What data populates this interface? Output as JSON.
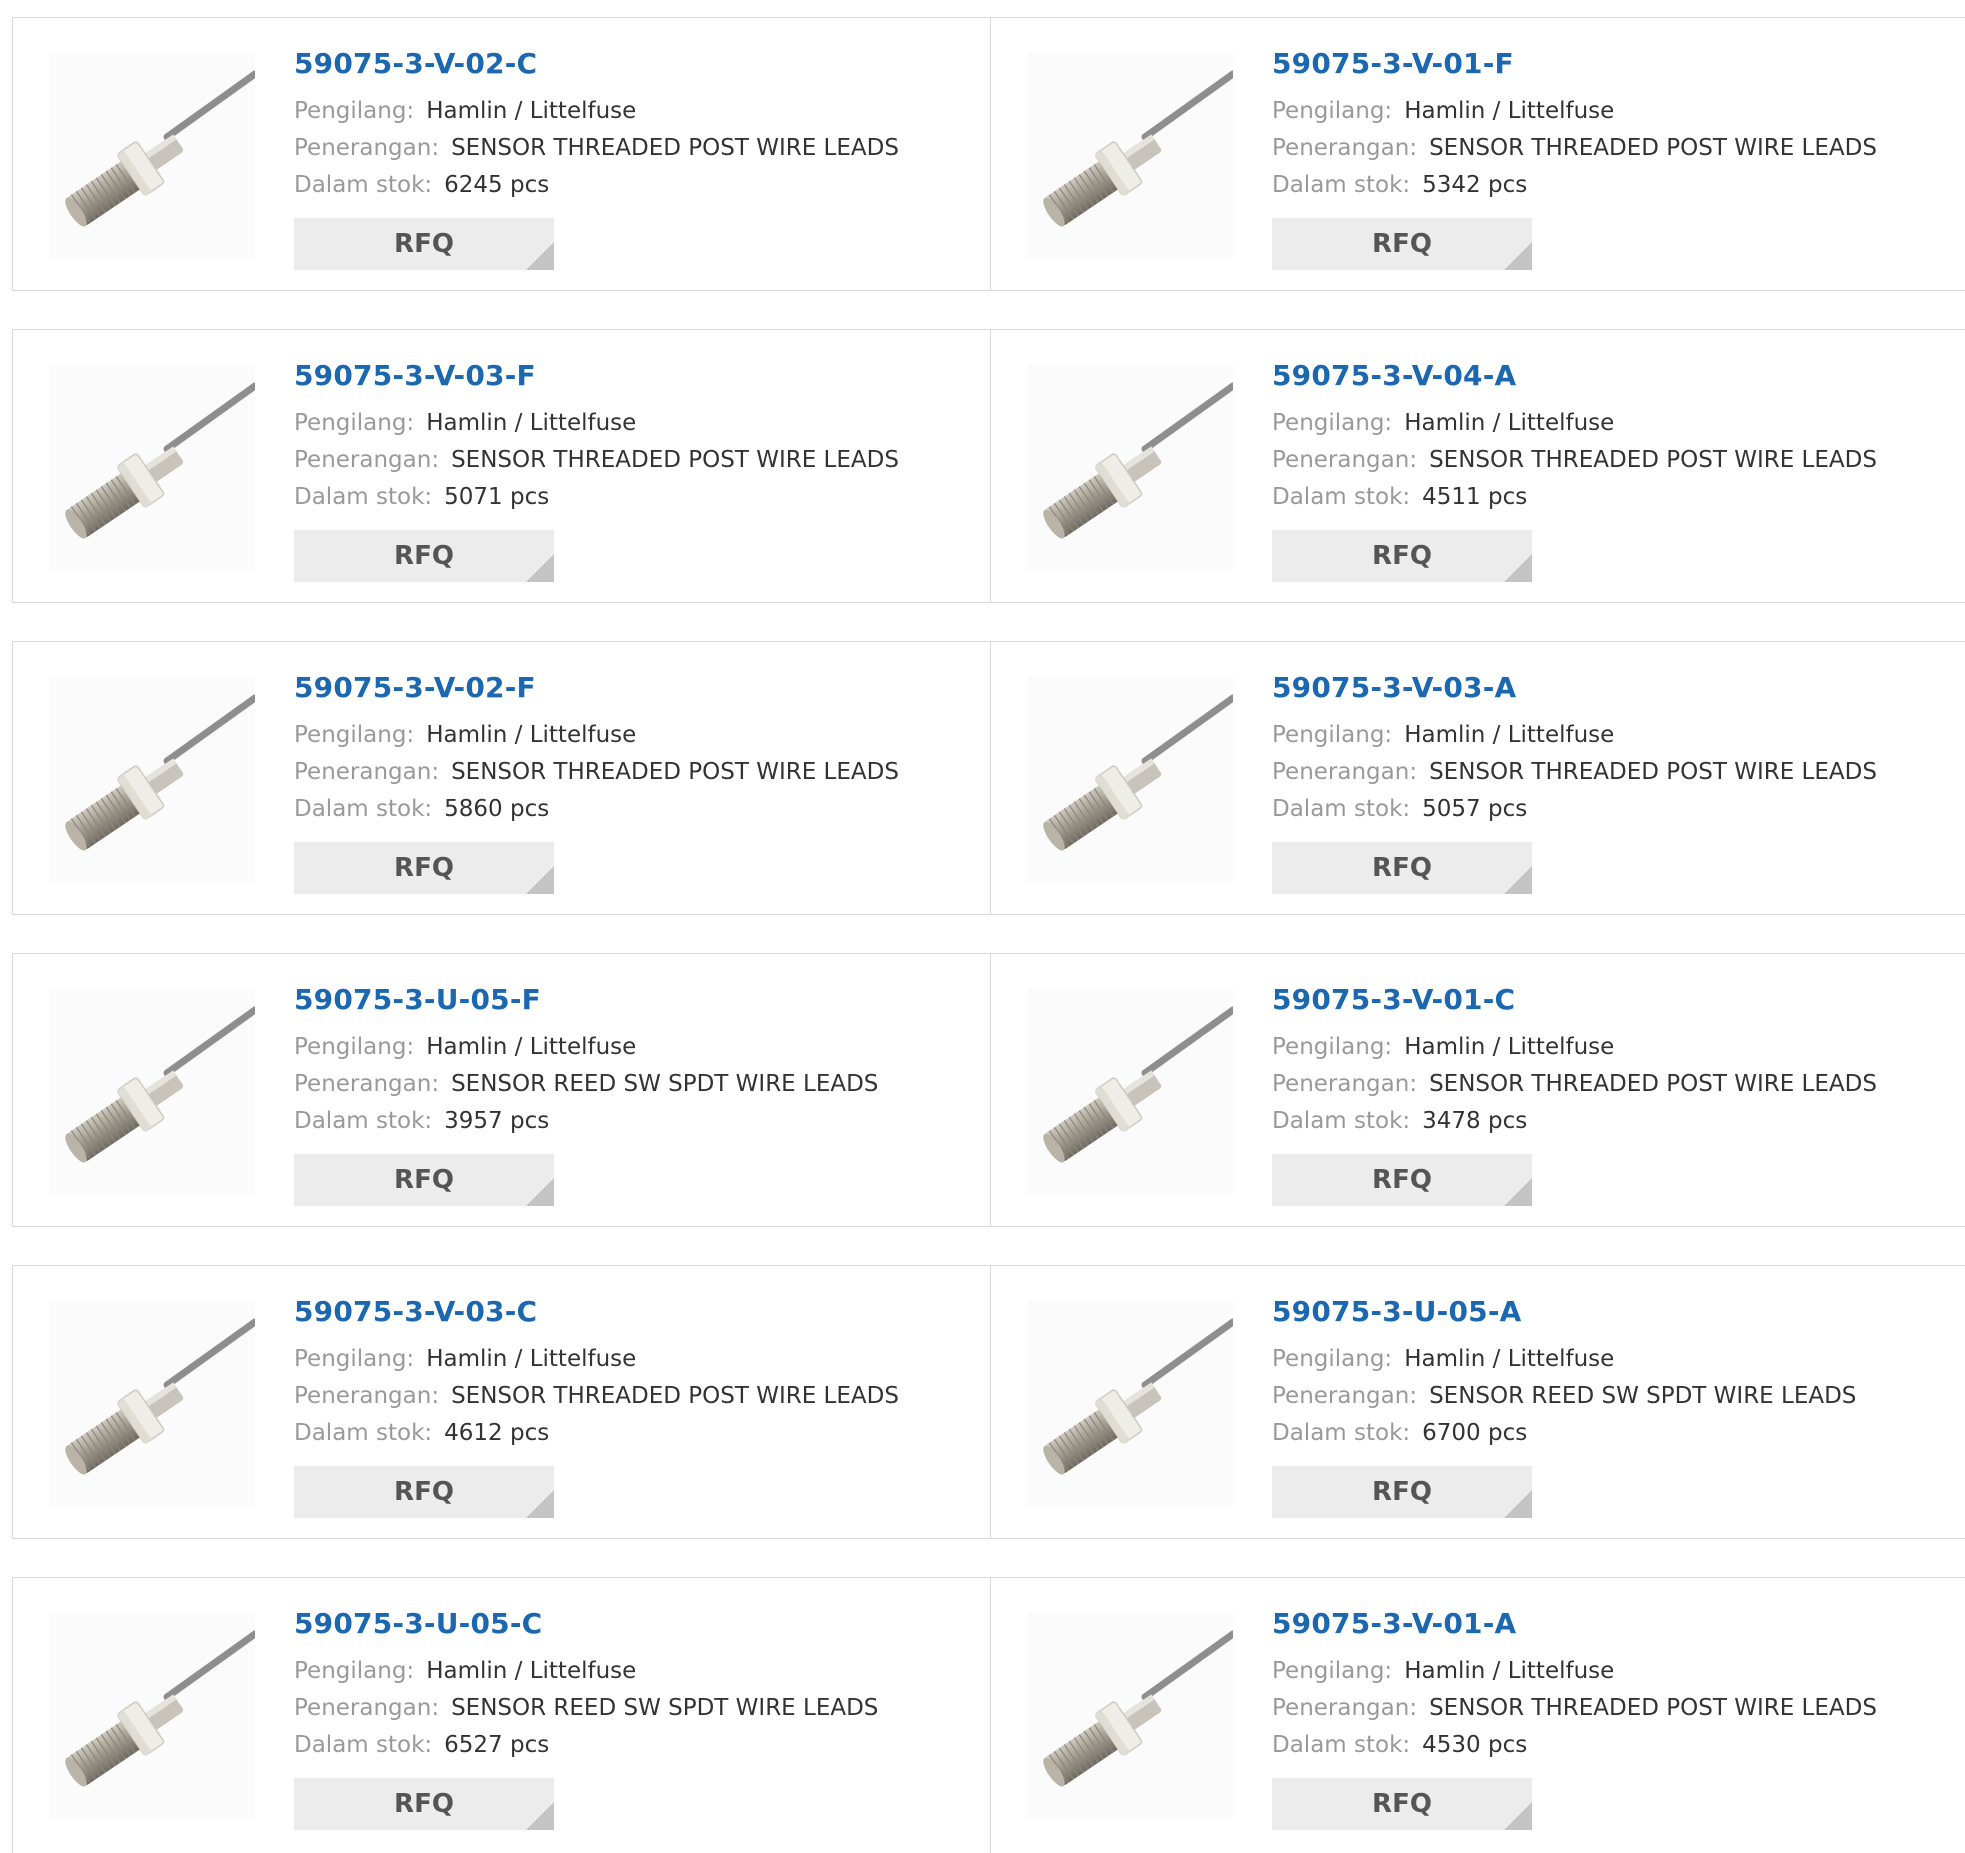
{
  "labels": {
    "manufacturer": "Pengilang:",
    "description": "Penerangan:",
    "stock": "Dalam stok:"
  },
  "products": [
    {
      "part": "59075-3-V-02-C",
      "manufacturer": "Hamlin / Littelfuse",
      "description": "SENSOR THREADED POST WIRE LEADS",
      "stock": "6245 pcs",
      "action": "RFQ"
    },
    {
      "part": "59075-3-V-01-F",
      "manufacturer": "Hamlin / Littelfuse",
      "description": "SENSOR THREADED POST WIRE LEADS",
      "stock": "5342 pcs",
      "action": "RFQ"
    },
    {
      "part": "59075-3-V-03-F",
      "manufacturer": "Hamlin / Littelfuse",
      "description": "SENSOR THREADED POST WIRE LEADS",
      "stock": "5071 pcs",
      "action": "RFQ"
    },
    {
      "part": "59075-3-V-04-A",
      "manufacturer": "Hamlin / Littelfuse",
      "description": "SENSOR THREADED POST WIRE LEADS",
      "stock": "4511 pcs",
      "action": "RFQ"
    },
    {
      "part": "59075-3-V-02-F",
      "manufacturer": "Hamlin / Littelfuse",
      "description": "SENSOR THREADED POST WIRE LEADS",
      "stock": "5860 pcs",
      "action": "RFQ"
    },
    {
      "part": "59075-3-V-03-A",
      "manufacturer": "Hamlin / Littelfuse",
      "description": "SENSOR THREADED POST WIRE LEADS",
      "stock": "5057 pcs",
      "action": "RFQ"
    },
    {
      "part": "59075-3-U-05-F",
      "manufacturer": "Hamlin / Littelfuse",
      "description": "SENSOR REED SW SPDT WIRE LEADS",
      "stock": "3957 pcs",
      "action": "RFQ"
    },
    {
      "part": "59075-3-V-01-C",
      "manufacturer": "Hamlin / Littelfuse",
      "description": "SENSOR THREADED POST WIRE LEADS",
      "stock": "3478 pcs",
      "action": "RFQ"
    },
    {
      "part": "59075-3-V-03-C",
      "manufacturer": "Hamlin / Littelfuse",
      "description": "SENSOR THREADED POST WIRE LEADS",
      "stock": "4612 pcs",
      "action": "RFQ"
    },
    {
      "part": "59075-3-U-05-A",
      "manufacturer": "Hamlin / Littelfuse",
      "description": "SENSOR REED SW SPDT WIRE LEADS",
      "stock": "6700 pcs",
      "action": "RFQ"
    },
    {
      "part": "59075-3-U-05-C",
      "manufacturer": "Hamlin / Littelfuse",
      "description": "SENSOR REED SW SPDT WIRE LEADS",
      "stock": "6527 pcs",
      "action": "RFQ"
    },
    {
      "part": "59075-3-V-01-A",
      "manufacturer": "Hamlin / Littelfuse",
      "description": "SENSOR THREADED POST WIRE LEADS",
      "stock": "4530 pcs",
      "action": "RFQ"
    }
  ],
  "colors": {
    "part_link": "#1c68b0",
    "label": "#999999",
    "value": "#333333",
    "button_bg": "#ececec",
    "button_text": "#555555",
    "border": "#d9d9d9"
  },
  "icons": {
    "product_image": "threaded-proximity-sensor-photo",
    "button_corner": "triangle-corner-icon"
  }
}
